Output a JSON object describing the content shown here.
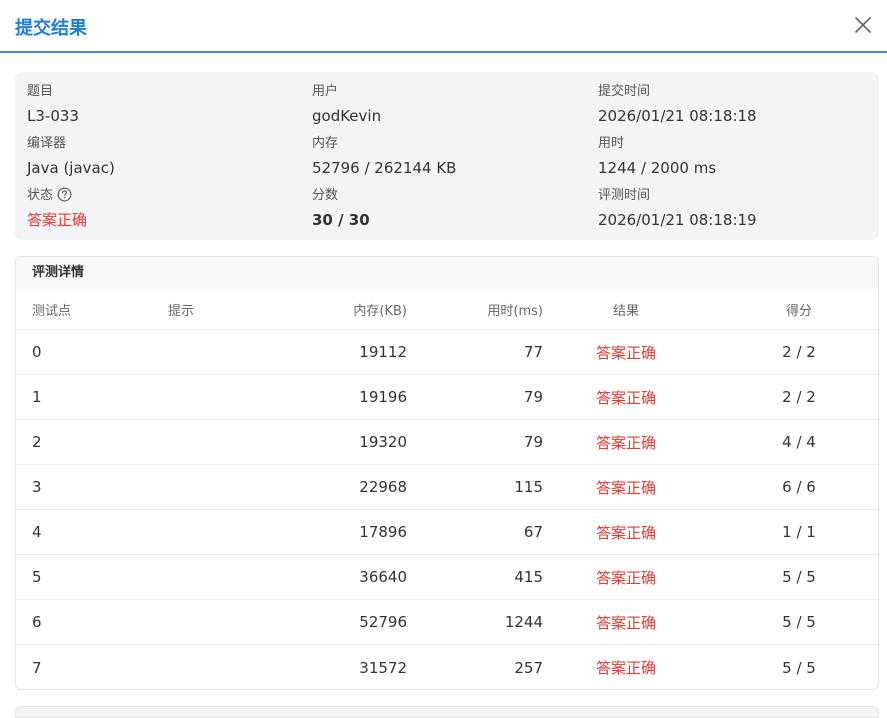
{
  "dialog": {
    "title": "提交结果"
  },
  "summary": {
    "problem_label": "题目",
    "problem_value": "L3-033",
    "user_label": "用户",
    "user_value": "godKevin",
    "submit_time_label": "提交时间",
    "submit_time_value": "2026/01/21 08:18:18",
    "compiler_label": "编译器",
    "compiler_value": "Java (javac)",
    "memory_label": "内存",
    "memory_value": "52796 / 262144 KB",
    "time_label": "用时",
    "time_value": "1244 / 2000 ms",
    "status_label": "状态",
    "status_value": "答案正确",
    "score_label": "分数",
    "score_value": "30 / 30",
    "judge_time_label": "评测时间",
    "judge_time_value": "2026/01/21 08:18:19"
  },
  "details": {
    "title": "评测详情",
    "columns": {
      "point": "测试点",
      "hint": "提示",
      "memory": "内存(KB)",
      "time": "用时(ms)",
      "result": "结果",
      "score": "得分"
    },
    "rows": [
      {
        "point": "0",
        "hint": "",
        "memory": "19112",
        "time": "77",
        "result": "答案正确",
        "score": "2 / 2"
      },
      {
        "point": "1",
        "hint": "",
        "memory": "19196",
        "time": "79",
        "result": "答案正确",
        "score": "2 / 2"
      },
      {
        "point": "2",
        "hint": "",
        "memory": "19320",
        "time": "79",
        "result": "答案正确",
        "score": "4 / 4"
      },
      {
        "point": "3",
        "hint": "",
        "memory": "22968",
        "time": "115",
        "result": "答案正确",
        "score": "6 / 6"
      },
      {
        "point": "4",
        "hint": "",
        "memory": "17896",
        "time": "67",
        "result": "答案正确",
        "score": "1 / 1"
      },
      {
        "point": "5",
        "hint": "",
        "memory": "36640",
        "time": "415",
        "result": "答案正确",
        "score": "5 / 5"
      },
      {
        "point": "6",
        "hint": "",
        "memory": "52796",
        "time": "1244",
        "result": "答案正确",
        "score": "5 / 5"
      },
      {
        "point": "7",
        "hint": "",
        "memory": "31572",
        "time": "257",
        "result": "答案正确",
        "score": "5 / 5"
      }
    ]
  },
  "icons": {
    "close": "close-icon",
    "help": "question-circle-icon"
  },
  "colors": {
    "accent": "#1f7fd6",
    "accepted": "#e53935"
  }
}
